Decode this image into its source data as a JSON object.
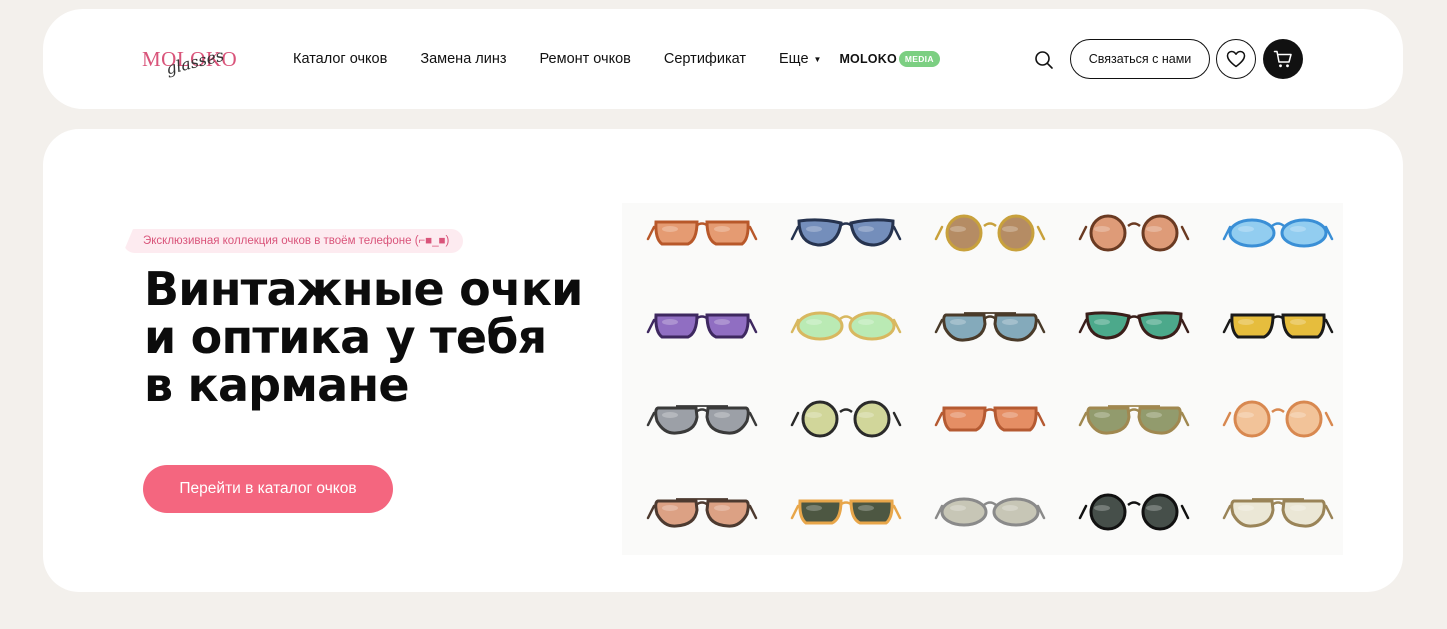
{
  "brand": {
    "logo_top": "MOLOKO",
    "logo_bottom": "glasses",
    "accent_color": "#f4667f",
    "logo_color": "#d9547a"
  },
  "nav": {
    "items": [
      "Каталог очков",
      "Замена линз",
      "Ремонт очков",
      "Сертификат"
    ],
    "more_label": "Еще",
    "media_label": "MOLOKO",
    "media_badge": "MEDIA",
    "media_badge_color": "#7ccf82"
  },
  "header_actions": {
    "search_icon": "search-icon",
    "contact_label": "Связаться с нами",
    "favorites_icon": "heart-icon",
    "cart_icon": "cart-icon"
  },
  "hero": {
    "tagline": "Эксклюзивная коллекция очков в твоём телефоне (⌐■_■)",
    "title_lines": [
      "Винтажные очки",
      "и оптика у тебя",
      "в кармане"
    ],
    "cta_label": "Перейти в каталог очков"
  },
  "glasses": [
    {
      "lens": "#e08a5a",
      "frame": "#b8582a",
      "shape": "square"
    },
    {
      "lens": "#5c7ab0",
      "frame": "#26334f",
      "shape": "cateye"
    },
    {
      "lens": "#a8784a",
      "frame": "#c8a13c",
      "shape": "round"
    },
    {
      "lens": "#d88a62",
      "frame": "#6a3a22",
      "shape": "round"
    },
    {
      "lens": "#7fc4ee",
      "frame": "#3a8fd6",
      "shape": "oval"
    },
    {
      "lens": "#7d55b8",
      "frame": "#3e2860",
      "shape": "square"
    },
    {
      "lens": "#aee6a8",
      "frame": "#d8b860",
      "shape": "oval"
    },
    {
      "lens": "#6e9bb0",
      "frame": "#4a3b2a",
      "shape": "aviator"
    },
    {
      "lens": "#2d9a78",
      "frame": "#3a1e1a",
      "shape": "cateye"
    },
    {
      "lens": "#e2b11c",
      "frame": "#1a1a1a",
      "shape": "square"
    },
    {
      "lens": "#8b8f99",
      "frame": "#3a3a3a",
      "shape": "aviator"
    },
    {
      "lens": "#c9cf8a",
      "frame": "#2a2a2a",
      "shape": "round"
    },
    {
      "lens": "#e07a4a",
      "frame": "#b55a32",
      "shape": "square"
    },
    {
      "lens": "#7f8a55",
      "frame": "#a08850",
      "shape": "aviator"
    },
    {
      "lens": "#f0b888",
      "frame": "#d88850",
      "shape": "round"
    },
    {
      "lens": "#d69070",
      "frame": "#4d3a30",
      "shape": "aviator"
    },
    {
      "lens": "#2e3a22",
      "frame": "#e8a64a",
      "shape": "square"
    },
    {
      "lens": "#bdbcaa",
      "frame": "#8a8a8a",
      "shape": "oval"
    },
    {
      "lens": "#26302c",
      "frame": "#111111",
      "shape": "round"
    },
    {
      "lens": "#e8e3d0",
      "frame": "#9a8458",
      "shape": "aviator"
    }
  ]
}
